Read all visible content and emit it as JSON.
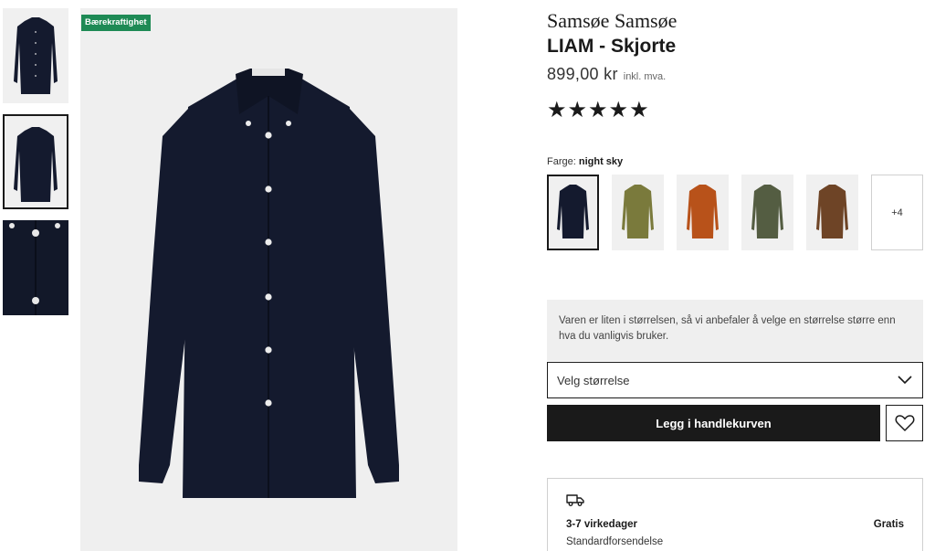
{
  "badge": "Bærekraftighet",
  "product": {
    "brand": "Samsøe Samsøe",
    "name": "LIAM - Skjorte",
    "price": "899,00 kr",
    "vat_note": "inkl. mva.",
    "rating_stars": "★★★★★",
    "rating": 5
  },
  "color": {
    "label": "Farge:",
    "selected": "night sky",
    "swatches": [
      {
        "name": "night sky",
        "hex": "#141a2e"
      },
      {
        "name": "olive",
        "hex": "#7a7a3c"
      },
      {
        "name": "orange",
        "hex": "#b8521a"
      },
      {
        "name": "green",
        "hex": "#545d42"
      },
      {
        "name": "brown",
        "hex": "#6e4426"
      }
    ],
    "more_label": "+4"
  },
  "notice": "Varen er liten i størrelsen, så vi anbefaler å velge en størrelse større enn hva du vanligvis bruker.",
  "size_select": {
    "placeholder": "Velg størrelse"
  },
  "actions": {
    "add_to_cart": "Legg i handlekurven"
  },
  "delivery": {
    "days": "3-7 virkedager",
    "price": "Gratis",
    "method": "Standardforsendelse"
  },
  "colors": {
    "badge_green": "#1e8a55",
    "button_black": "#1a1a1a",
    "shirt": "#141a2e"
  }
}
